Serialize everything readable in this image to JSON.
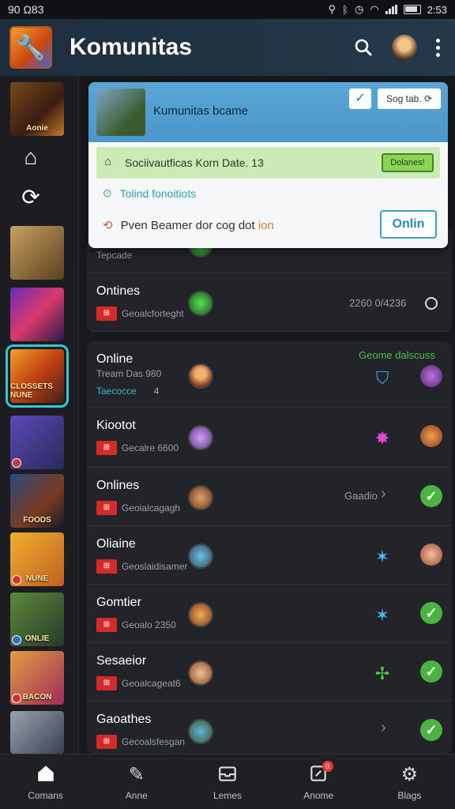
{
  "status_bar": {
    "time_left": "90 Ω83",
    "time_right": "2:53"
  },
  "header": {
    "title": "Komunitas",
    "search_icon": "search-icon",
    "menu_icon": "more-vertical-icon"
  },
  "sidebar": {
    "games": [
      {
        "label": "Aonie",
        "bg": "linear-gradient(135deg,#7a4a1c,#3a1c10 60%,#c77a2a)"
      },
      {
        "label": "",
        "bg": "linear-gradient(135deg,#c8a060,#5a4020)"
      },
      {
        "label": "",
        "bg": "linear-gradient(135deg,#6a2ab8,#d83a6a 50%,#2a1a48)"
      },
      {
        "label": "CLOSSETS NUNE",
        "bg": "linear-gradient(135deg,#f0a030,#c24010 50%,#40201a)"
      },
      {
        "label": "",
        "bg": "linear-gradient(135deg,#5a4ab8,#2a2a5a)"
      },
      {
        "label": "FOODS",
        "bg": "linear-gradient(135deg,#2a4a7a,#7a3a20 60%,#1a1a2a)"
      },
      {
        "label": "NUNE",
        "bg": "linear-gradient(135deg,#f0b030,#c06020)"
      },
      {
        "label": "ONLIE",
        "bg": "linear-gradient(135deg,#5a8a3a,#2a3a2a)"
      },
      {
        "label": "BACON",
        "bg": "linear-gradient(135deg,#e0a040,#a02a5a)"
      },
      {
        "label": "",
        "bg": "linear-gradient(135deg,#9aa2b0,#3a4050)"
      }
    ]
  },
  "popup": {
    "title": "Kumunitas bcame",
    "header_button": "Sog tab.",
    "strip_text": "Sociivautficas Korn Date. 13",
    "strip_button": "Dolanes!",
    "line1": "Tolind fonoitiots",
    "line2_main": "Pven Beamer dor cog dot",
    "line2_accent": "ion",
    "online_button": "Onlin"
  },
  "list_top": [
    {
      "title": "",
      "sub": "Tepcade"
    },
    {
      "title": "Ontines",
      "sub": "Geoalcforteght",
      "meta": "2260 0/4236"
    }
  ],
  "list": [
    {
      "title": "Online",
      "sub": "Tream Das 980",
      "sub2": "Taecocce",
      "green": "Geome dalscuss"
    },
    {
      "title": "Kiootot",
      "sub": "Gecalre 6600"
    },
    {
      "title": "Onlines",
      "sub": "Geoialcagagh",
      "meta": "Gaadio"
    },
    {
      "title": "Oliaine",
      "sub": "Geoslaidisamer"
    },
    {
      "title": "Gomtier",
      "sub": "Geoalo 2350"
    },
    {
      "title": "Sesaeior",
      "sub": "Geoalcageat6"
    },
    {
      "title": "Gaoathes",
      "sub": "Gecoalsfesgan"
    }
  ],
  "bottom_nav": [
    {
      "label": "Comans",
      "icon": "home-icon"
    },
    {
      "label": "Anne",
      "icon": "edit-icon"
    },
    {
      "label": "Lemes",
      "icon": "inbox-icon"
    },
    {
      "label": "Anome",
      "icon": "notifications-icon",
      "badge": "0"
    },
    {
      "label": "Blags",
      "icon": "settings-icon"
    }
  ],
  "colors": {
    "accent": "#36c6d6",
    "check": "#4bb33f",
    "tag": "#d42a2a",
    "header": "#24394a"
  }
}
